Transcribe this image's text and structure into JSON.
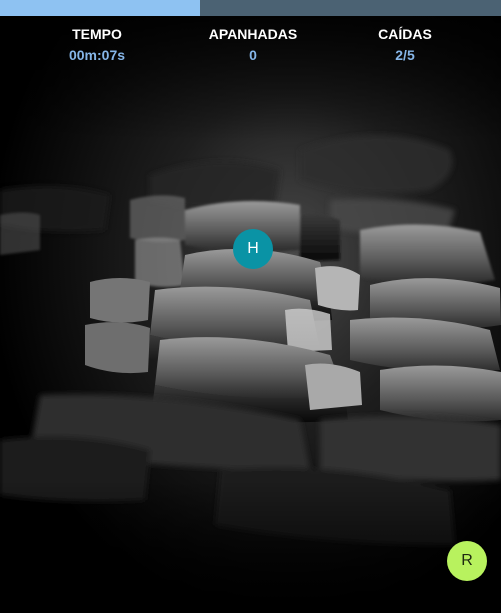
{
  "progress": {
    "fraction": 0.4,
    "fill_color": "#8ec2f2",
    "track_color": "#4b6273"
  },
  "stats": {
    "time_label": "TEMPO",
    "time_value": "00m:07s",
    "caught_label": "APANHADAS",
    "caught_value": "0",
    "dropped_label": "CAÍDAS",
    "dropped_value": "2/5"
  },
  "balls": [
    {
      "letter": "H",
      "color": "#0a93a5"
    },
    {
      "letter": "R",
      "color": "#b8f25e"
    }
  ]
}
